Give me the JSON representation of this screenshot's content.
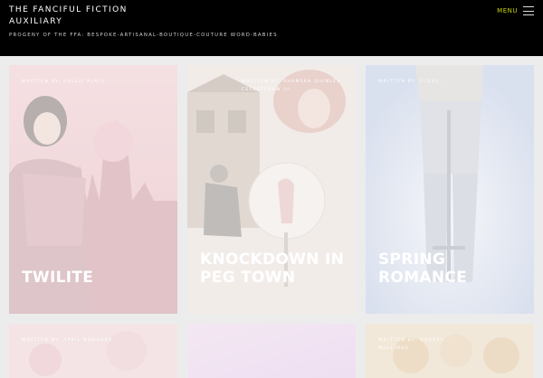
{
  "header": {
    "site_title": "THE FANCIFUL FICTION AUXILIARY",
    "site_description": "PROGENY OF THE FFA: BESPOKE-ARTISANAL-BOUTIQUE-COUTURE WORD-BABIES",
    "menu_label": "MENU"
  },
  "colors": {
    "header_bg": "#000000",
    "menu_accent": "#c8d400",
    "page_bg": "#ececec"
  },
  "cards": [
    {
      "meta": "WRITTEN BY: SALLIE PLATE",
      "title": "TWILITE"
    },
    {
      "meta": "WRITTEN BY: SHAMEKA QUINLEY CELESTEREW III",
      "title": "KNOCKDOWN IN PEG TOWN"
    },
    {
      "meta": "WRITTEN BY: FLOSS ...",
      "title": "SPRING ROMANCE"
    },
    {
      "meta": "WRITTEN BY: APRIL ROGGERS",
      "title": ""
    },
    {
      "meta": "",
      "title": ""
    },
    {
      "meta": "WRITTEN BY: HOBERT ... MULLINGS",
      "title": ""
    }
  ]
}
